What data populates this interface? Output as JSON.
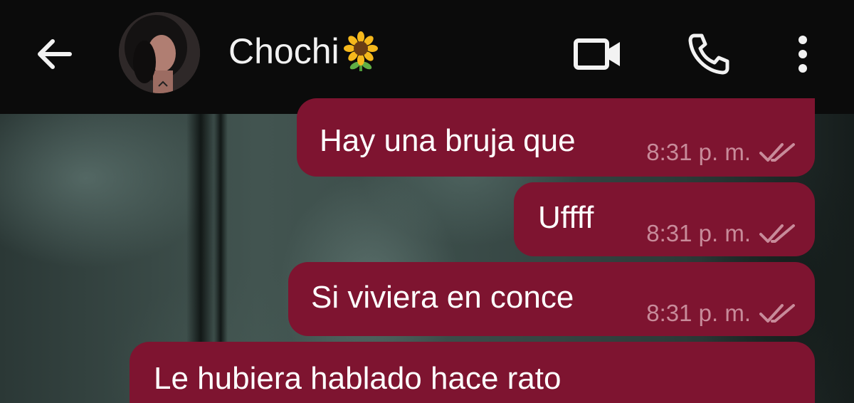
{
  "header": {
    "back_icon": "arrow-left-icon",
    "avatar_icon": "contact-avatar",
    "contact_name": "Chochi",
    "contact_emoji": "sunflower-emoji",
    "actions": [
      {
        "name": "video-call",
        "icon": "video-camera-icon"
      },
      {
        "name": "voice-call",
        "icon": "phone-icon"
      },
      {
        "name": "more-options",
        "icon": "more-vertical-icon"
      }
    ]
  },
  "messages": [
    {
      "text": "Hay una bruja que",
      "time": "8:31 p. m.",
      "status_icon": "double-check-icon"
    },
    {
      "text": "Uffff",
      "time": "8:31 p. m.",
      "status_icon": "double-check-icon"
    },
    {
      "text": "Si viviera en conce",
      "time": "8:31 p. m.",
      "status_icon": "double-check-icon"
    },
    {
      "text": "Le hubiera hablado hace rato",
      "time": "",
      "status_icon": ""
    }
  ],
  "colors": {
    "header_bg": "#0b0b0b",
    "bubble_bg": "#7e1430",
    "bubble_text": "#ffffff",
    "bubble_meta": "#c88b9a"
  }
}
